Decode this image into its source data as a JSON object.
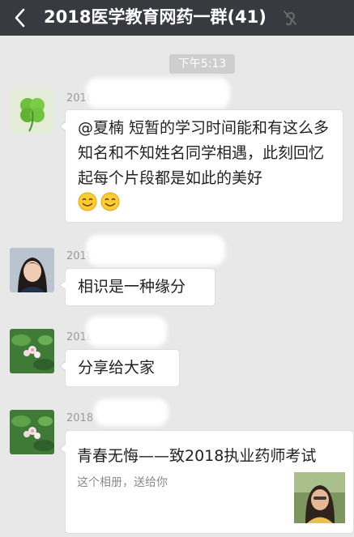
{
  "header": {
    "title": "2018医学教育网药一群(41)",
    "back_icon": "chevron-left-icon",
    "mute_icon": "ear-mute-icon"
  },
  "timestamp": "下午5:13",
  "messages": [
    {
      "sender": "2018",
      "text": "@夏楠  短暂的学习时间能和有这么多知名和不知姓名同学相遇，此刻回忆起每个片段都是如此的美好",
      "emoji_count": 2,
      "avatar": "clover-avatar"
    },
    {
      "sender": "2018",
      "text": "相识是一种缘分",
      "avatar": "girl-avatar"
    },
    {
      "sender": "2018",
      "text": "分享给大家",
      "avatar": "flower-avatar"
    },
    {
      "sender": "2018",
      "avatar": "flower-avatar"
    }
  ],
  "share_card": {
    "title": "青春无悔——致2018执业药师考试",
    "description": "这个相册，送给你"
  },
  "colors": {
    "titlebar": "#393a3f",
    "chat_bg": "#e8e8e8",
    "bubble": "#ffffff",
    "time_pill": "#cecece"
  }
}
